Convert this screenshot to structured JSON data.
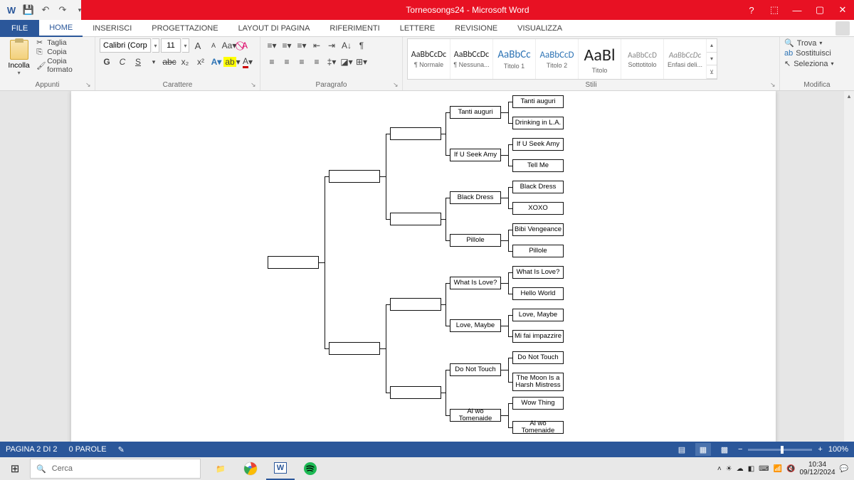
{
  "title": "Torneosongs24 - Microsoft Word",
  "tabs": {
    "file": "FILE",
    "home": "HOME",
    "insert": "INSERISCI",
    "design": "PROGETTAZIONE",
    "layout": "LAYOUT DI PAGINA",
    "references": "RIFERIMENTI",
    "mailings": "LETTERE",
    "review": "REVISIONE",
    "view": "VISUALIZZA"
  },
  "clipboard": {
    "paste": "Incolla",
    "cut": "Taglia",
    "copy": "Copia",
    "format_painter": "Copia formato",
    "group": "Appunti"
  },
  "font": {
    "name": "Calibri (Corp",
    "size": "11",
    "group": "Carattere"
  },
  "paragraph": {
    "group": "Paragrafo"
  },
  "styles": {
    "group": "Stili",
    "items": [
      {
        "preview": "AaBbCcDc",
        "name": "¶ Normale",
        "size": "12px",
        "color": "#222"
      },
      {
        "preview": "AaBbCcDc",
        "name": "¶ Nessuna...",
        "size": "12px",
        "color": "#222"
      },
      {
        "preview": "AaBbCc",
        "name": "Titolo 1",
        "size": "15px",
        "color": "#2e74b5"
      },
      {
        "preview": "AaBbCcD",
        "name": "Titolo 2",
        "size": "13px",
        "color": "#2e74b5"
      },
      {
        "preview": "AaBl",
        "name": "Titolo",
        "size": "24px",
        "color": "#222"
      },
      {
        "preview": "AaBbCcD",
        "name": "Sottotitolo",
        "size": "11px",
        "color": "#888"
      },
      {
        "preview": "AaBbCcDc",
        "name": "Enfasi deli...",
        "size": "11px",
        "color": "#888",
        "italic": true
      }
    ]
  },
  "editing": {
    "find": "Trova",
    "replace": "Sostituisci",
    "select": "Seleziona",
    "group": "Modifica"
  },
  "status": {
    "page": "PAGINA 2 DI 2",
    "words": "0 PAROLE",
    "zoom": "100%"
  },
  "taskbar": {
    "search_placeholder": "Cerca",
    "time": "10:34",
    "date": "09/12/2024"
  },
  "bracket": {
    "r16": [
      "Tanti auguri",
      "Drinking in L.A.",
      "If U Seek Amy",
      "Tell Me",
      "Black Dress",
      "XOXO",
      "Bibi Vengeance",
      "Pillole",
      "What Is Love?",
      "Hello World",
      "Love, Maybe",
      "Mi fai impazzire",
      "Do Not Touch",
      "The Moon Is a Harsh Mistress",
      "Wow Thing",
      "Ai wo Tomenaide"
    ],
    "r8": [
      "Tanti auguri",
      "If U Seek Amy",
      "Black Dress",
      "Pillole",
      "What Is Love?",
      "Love, Maybe",
      "Do Not Touch",
      "Ai wo Tomenaide"
    ],
    "r4": [
      "",
      "",
      "",
      ""
    ],
    "r2": [
      "",
      ""
    ],
    "r1": [
      ""
    ]
  }
}
